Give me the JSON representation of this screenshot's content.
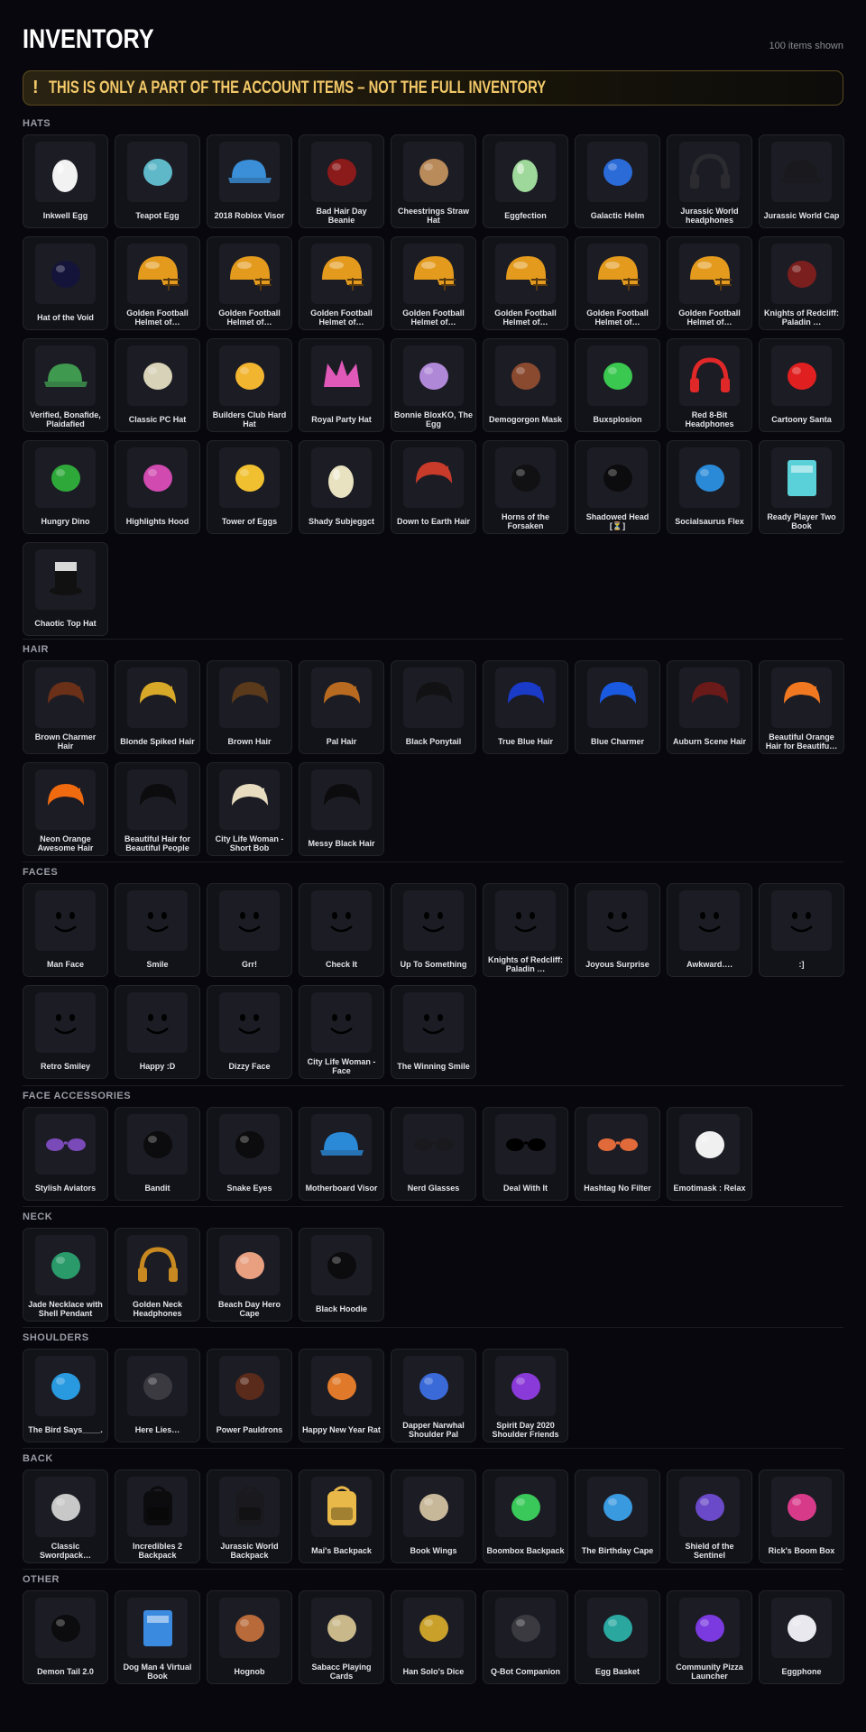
{
  "title": "INVENTORY",
  "count": "100 items shown",
  "banner": {
    "icon": "!",
    "text": "THIS IS ONLY A PART OF THE ACCOUNT ITEMS – NOT THE FULL INVENTORY"
  },
  "colors": {
    "background": "#07070d",
    "card": "#121219",
    "accent": "#f3c969"
  },
  "sections": [
    {
      "label": "HATS",
      "items": [
        {
          "name": "Inkwell Egg",
          "icon": "egg-icon",
          "color": "#f2f2f2"
        },
        {
          "name": "Teapot Egg",
          "icon": "teapot-icon",
          "color": "#5fb8c8"
        },
        {
          "name": "2018 Roblox Visor",
          "icon": "visor-icon",
          "color": "#3a8fd8"
        },
        {
          "name": "Bad Hair Day Beanie",
          "icon": "beanie-icon",
          "color": "#8b1a1a"
        },
        {
          "name": "Cheestrings Straw Hat",
          "icon": "straw-hat-icon",
          "color": "#b98a5a"
        },
        {
          "name": "Eggfection",
          "icon": "egg-icon",
          "color": "#9ed89a"
        },
        {
          "name": "Galactic Helm",
          "icon": "helm-icon",
          "color": "#2a6bd8"
        },
        {
          "name": "Jurassic World headphones",
          "icon": "headphones-icon",
          "color": "#2b2b30"
        },
        {
          "name": "Jurassic World Cap",
          "icon": "cap-icon",
          "color": "#1a1a1e"
        },
        {
          "name": "Hat of the Void",
          "icon": "wizard-hat-icon",
          "color": "#14143a"
        },
        {
          "name": "Golden Football Helmet of…",
          "icon": "football-helmet-icon",
          "color": "#e39a1d"
        },
        {
          "name": "Golden Football Helmet of…",
          "icon": "football-helmet-icon",
          "color": "#e39a1d"
        },
        {
          "name": "Golden Football Helmet of…",
          "icon": "football-helmet-icon",
          "color": "#e39a1d"
        },
        {
          "name": "Golden Football Helmet of…",
          "icon": "football-helmet-icon",
          "color": "#e39a1d"
        },
        {
          "name": "Golden Football Helmet of…",
          "icon": "football-helmet-icon",
          "color": "#e39a1d"
        },
        {
          "name": "Golden Football Helmet of…",
          "icon": "football-helmet-icon",
          "color": "#e39a1d"
        },
        {
          "name": "Golden Football Helmet of…",
          "icon": "football-helmet-icon",
          "color": "#e39a1d"
        },
        {
          "name": "Knights of Redcliff: Paladin …",
          "icon": "knight-helm-icon",
          "color": "#7a1e1e"
        },
        {
          "name": "Verified, Bonafide, Plaidafied",
          "icon": "plaid-cap-icon",
          "color": "#3f9a4f"
        },
        {
          "name": "Classic PC Hat",
          "icon": "pc-icon",
          "color": "#d8d2b8"
        },
        {
          "name": "Builders Club Hard Hat",
          "icon": "hard-hat-icon",
          "color": "#f2b530"
        },
        {
          "name": "Royal Party Hat",
          "icon": "crown-icon",
          "color": "#e058b8"
        },
        {
          "name": "Bonnie BloxKO, The Egg",
          "icon": "bunny-egg-icon",
          "color": "#b088d8"
        },
        {
          "name": "Demogorgon Mask",
          "icon": "demogorgon-icon",
          "color": "#8a4a30"
        },
        {
          "name": "Buxsplosion",
          "icon": "bux-icon",
          "color": "#3ac850"
        },
        {
          "name": "Red 8-Bit Headphones",
          "icon": "headphones-icon",
          "color": "#e02828"
        },
        {
          "name": "Cartoony Santa",
          "icon": "santa-hat-icon",
          "color": "#e02020"
        },
        {
          "name": "Hungry Dino",
          "icon": "dino-icon",
          "color": "#2fa83a"
        },
        {
          "name": "Highlights Hood",
          "icon": "hood-icon",
          "color": "#d04ab0"
        },
        {
          "name": "Tower of Eggs",
          "icon": "egg-tower-icon",
          "color": "#f0c030"
        },
        {
          "name": "Shady Subjeggct",
          "icon": "egg-icon",
          "color": "#e8e2c0"
        },
        {
          "name": "Down to Earth Hair",
          "icon": "hair-icon",
          "color": "#c83a2a"
        },
        {
          "name": "Horns of the Forsaken",
          "icon": "horns-icon",
          "color": "#111114"
        },
        {
          "name": "Shadowed Head [⏳]",
          "icon": "head-icon",
          "color": "#0c0c0e"
        },
        {
          "name": "Socialsaurus Flex",
          "icon": "dino-icon",
          "color": "#2a8ad8"
        },
        {
          "name": "Ready Player Two Book",
          "icon": "book-icon",
          "color": "#5ad0d8"
        },
        {
          "name": "Chaotic Top Hat",
          "icon": "top-hat-icon",
          "color": "#d8d8d8"
        }
      ]
    },
    {
      "label": "HAIR",
      "items": [
        {
          "name": "Brown Charmer Hair",
          "icon": "hair-icon",
          "color": "#6a3018"
        },
        {
          "name": "Blonde Spiked Hair",
          "icon": "hair-icon",
          "color": "#d8a828"
        },
        {
          "name": "Brown Hair",
          "icon": "hair-icon",
          "color": "#5a3a1a"
        },
        {
          "name": "Pal Hair",
          "icon": "hair-icon",
          "color": "#b86a20"
        },
        {
          "name": "Black Ponytail",
          "icon": "hair-icon",
          "color": "#121214"
        },
        {
          "name": "True Blue Hair",
          "icon": "hair-icon",
          "color": "#1a3ac8"
        },
        {
          "name": "Blue Charmer",
          "icon": "hair-icon",
          "color": "#1a5ae0"
        },
        {
          "name": "Auburn Scene Hair",
          "icon": "hair-icon",
          "color": "#6a1a18"
        },
        {
          "name": "Beautiful Orange Hair for Beautifu…",
          "icon": "hair-icon",
          "color": "#f07820"
        },
        {
          "name": "Neon Orange Awesome Hair",
          "icon": "hair-icon",
          "color": "#f06a10"
        },
        {
          "name": "Beautiful Hair for Beautiful People",
          "icon": "hair-icon",
          "color": "#0c0c0e"
        },
        {
          "name": "City Life Woman - Short Bob",
          "icon": "hair-icon",
          "color": "#e8dcc0"
        },
        {
          "name": "Messy Black Hair",
          "icon": "hair-icon",
          "color": "#0c0c0e"
        }
      ]
    },
    {
      "label": "FACES",
      "items": [
        {
          "name": "Man Face",
          "icon": "face-icon",
          "color": "#000000"
        },
        {
          "name": "Smile",
          "icon": "face-icon",
          "color": "#000000"
        },
        {
          "name": "Grr!",
          "icon": "face-icon",
          "color": "#000000"
        },
        {
          "name": "Check It",
          "icon": "face-icon",
          "color": "#000000"
        },
        {
          "name": "Up To Something",
          "icon": "face-icon",
          "color": "#000000"
        },
        {
          "name": "Knights of Redcliff: Paladin …",
          "icon": "face-icon",
          "color": "#c82020"
        },
        {
          "name": "Joyous Surprise",
          "icon": "face-icon",
          "color": "#000000"
        },
        {
          "name": "Awkward….",
          "icon": "face-icon",
          "color": "#000000"
        },
        {
          "name": ":]",
          "icon": "face-icon",
          "color": "#000000"
        },
        {
          "name": "Retro Smiley",
          "icon": "face-icon",
          "color": "#000000"
        },
        {
          "name": "Happy :D",
          "icon": "face-icon",
          "color": "#000000"
        },
        {
          "name": "Dizzy Face",
          "icon": "face-icon",
          "color": "#000000"
        },
        {
          "name": "City Life Woman - Face",
          "icon": "face-icon",
          "color": "#5a3020"
        },
        {
          "name": "The Winning Smile",
          "icon": "face-icon",
          "color": "#000000"
        }
      ]
    },
    {
      "label": "FACE ACCESSORIES",
      "items": [
        {
          "name": "Stylish Aviators",
          "icon": "sunglasses-icon",
          "color": "#7a4ab8"
        },
        {
          "name": "Bandit",
          "icon": "bandana-icon",
          "color": "#0c0c0e"
        },
        {
          "name": "Snake Eyes",
          "icon": "visor-mask-icon",
          "color": "#0c0c0e"
        },
        {
          "name": "Motherboard Visor",
          "icon": "visor-icon",
          "color": "#2a8ad8"
        },
        {
          "name": "Nerd Glasses",
          "icon": "glasses-icon",
          "color": "#1a1a1e"
        },
        {
          "name": "Deal With It",
          "icon": "pixel-glasses-icon",
          "color": "#000000"
        },
        {
          "name": "Hashtag No Filter",
          "icon": "sunglasses-icon",
          "color": "#e06a3a"
        },
        {
          "name": "Emotimask : Relax",
          "icon": "mask-icon",
          "color": "#f0f0f0"
        }
      ]
    },
    {
      "label": "NECK",
      "items": [
        {
          "name": "Jade Necklace with Shell Pendant",
          "icon": "necklace-icon",
          "color": "#2a9a6a"
        },
        {
          "name": "Golden Neck Headphones",
          "icon": "headphones-icon",
          "color": "#c88a20"
        },
        {
          "name": "Beach Day Hero Cape",
          "icon": "cape-icon",
          "color": "#e8a080"
        },
        {
          "name": "Black Hoodie",
          "icon": "hoodie-icon",
          "color": "#0c0c0e"
        }
      ]
    },
    {
      "label": "SHOULDERS",
      "items": [
        {
          "name": "The Bird Says____.",
          "icon": "bird-icon",
          "color": "#2a9ae0"
        },
        {
          "name": "Here Lies…",
          "icon": "tombstone-icon",
          "color": "#3a3a40"
        },
        {
          "name": "Power Pauldrons",
          "icon": "pauldron-icon",
          "color": "#5a2a1a"
        },
        {
          "name": "Happy New Year Rat",
          "icon": "rat-icon",
          "color": "#e07a2a"
        },
        {
          "name": "Dapper Narwhal Shoulder Pal",
          "icon": "narwhal-icon",
          "color": "#3a6ad8"
        },
        {
          "name": "Spirit Day 2020 Shoulder Friends",
          "icon": "friends-icon",
          "color": "#8a3ad8"
        }
      ]
    },
    {
      "label": "BACK",
      "items": [
        {
          "name": "Classic Swordpack…",
          "icon": "swords-icon",
          "color": "#c8c8c8"
        },
        {
          "name": "Incredibles 2 Backpack",
          "icon": "backpack-icon",
          "color": "#0c0c0e"
        },
        {
          "name": "Jurassic World Backpack",
          "icon": "backpack-icon",
          "color": "#1a1a1e"
        },
        {
          "name": "Mai's Backpack",
          "icon": "backpack-icon",
          "color": "#e8b848"
        },
        {
          "name": "Book Wings",
          "icon": "wings-icon",
          "color": "#c8b89a"
        },
        {
          "name": "Boombox Backpack",
          "icon": "boombox-icon",
          "color": "#3ac85a"
        },
        {
          "name": "The Birthday Cape",
          "icon": "cape-icon",
          "color": "#3a9ae0"
        },
        {
          "name": "Shield of the Sentinel",
          "icon": "shield-icon",
          "color": "#6a4ac8"
        },
        {
          "name": "Rick's Boom Box",
          "icon": "boombox-icon",
          "color": "#d83a8a"
        }
      ]
    },
    {
      "label": "OTHER",
      "items": [
        {
          "name": "Demon Tail 2.0",
          "icon": "tail-icon",
          "color": "#0c0c0e"
        },
        {
          "name": "Dog Man 4 Virtual Book",
          "icon": "book-icon",
          "color": "#3a8ae0"
        },
        {
          "name": "Hognob",
          "icon": "hog-icon",
          "color": "#b86a3a"
        },
        {
          "name": "Sabacc Playing Cards",
          "icon": "cards-icon",
          "color": "#c8b88a"
        },
        {
          "name": "Han Solo's Dice",
          "icon": "dice-icon",
          "color": "#c8a02a"
        },
        {
          "name": "Q-Bot Companion",
          "icon": "robot-icon",
          "color": "#3a3a40"
        },
        {
          "name": "Egg Basket",
          "icon": "basket-icon",
          "color": "#2aa8a0"
        },
        {
          "name": "Community Pizza Launcher",
          "icon": "launcher-icon",
          "color": "#7a3ae0"
        },
        {
          "name": "Eggphone",
          "icon": "phone-icon",
          "color": "#e8e8ee"
        }
      ]
    }
  ]
}
